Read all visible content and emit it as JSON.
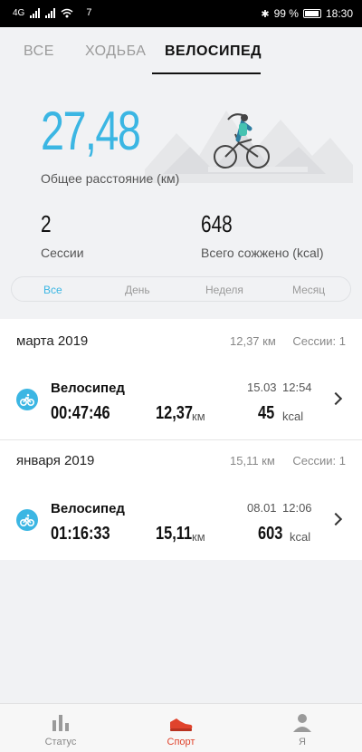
{
  "status_bar": {
    "network": "4G",
    "notif_count": "7",
    "battery": "99 %",
    "time": "18:30"
  },
  "tabs": [
    {
      "label": "ВСЕ",
      "active": false
    },
    {
      "label": "ХОДЬБА",
      "active": false
    },
    {
      "label": "ВЕЛОСИПЕД",
      "active": true
    }
  ],
  "summary": {
    "distance_value": "27,48",
    "distance_label": "Общее расстояние (км)",
    "sessions_value": "2",
    "sessions_label": "Сессии",
    "calories_value": "648",
    "calories_label": "Всего сожжено (kcal)"
  },
  "period_filter": [
    {
      "label": "Все",
      "active": true
    },
    {
      "label": "День",
      "active": false
    },
    {
      "label": "Неделя",
      "active": false
    },
    {
      "label": "Месяц",
      "active": false
    }
  ],
  "months": [
    {
      "title": "марта 2019",
      "km": "12,37 км",
      "sessions": "Сессии: 1",
      "activities": [
        {
          "name": "Велосипед",
          "date": "15.03",
          "time": "12:54",
          "duration": "00:47:46",
          "distance": "12,37",
          "distance_unit": "км",
          "calories": "45",
          "calories_unit": "kcal"
        }
      ]
    },
    {
      "title": "января 2019",
      "km": "15,11 км",
      "sessions": "Сессии: 1",
      "activities": [
        {
          "name": "Велосипед",
          "date": "08.01",
          "time": "12:06",
          "duration": "01:16:33",
          "distance": "15,11",
          "distance_unit": "км",
          "calories": "603",
          "calories_unit": "kcal"
        }
      ]
    }
  ],
  "bottom_nav": [
    {
      "label": "Статус",
      "icon": "bar-chart-icon",
      "active": false
    },
    {
      "label": "Спорт",
      "icon": "sneaker-icon",
      "active": true
    },
    {
      "label": "Я",
      "icon": "person-icon",
      "active": false
    }
  ],
  "colors": {
    "accent": "#3bb6e3",
    "nav_active": "#e0432c"
  }
}
